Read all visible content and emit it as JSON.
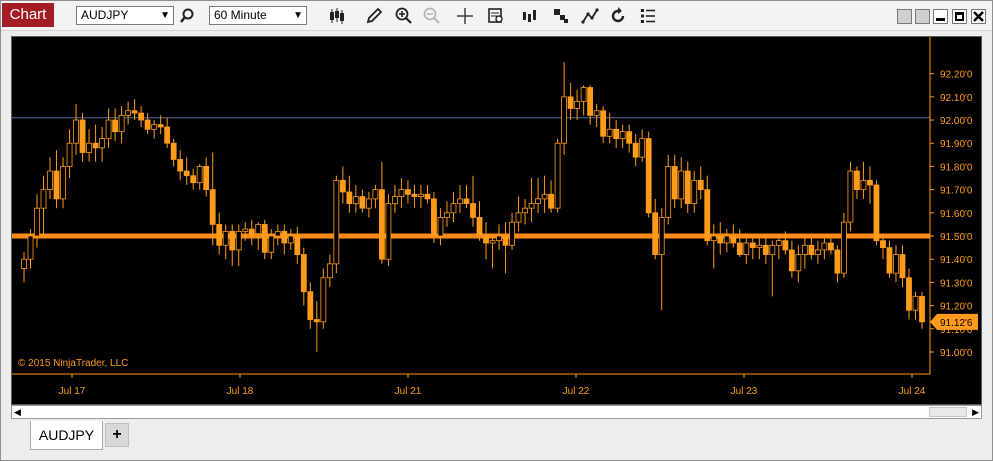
{
  "window": {
    "title": "Chart"
  },
  "toolbar": {
    "instrument": "AUDJPY",
    "interval": "60 Minute",
    "icons": [
      "search-icon",
      "bar-type-icon",
      "pencil-icon",
      "zoom-in-icon",
      "zoom-out-icon",
      "crosshair-icon",
      "data-box-icon",
      "indicators-icon",
      "strategies-icon",
      "drawing-tools-icon",
      "reload-icon",
      "properties-icon"
    ]
  },
  "tabs": [
    {
      "label": "AUDJPY"
    }
  ],
  "add_tab_label": "+",
  "chart_data": {
    "type": "candlestick",
    "instrument": "AUDJPY",
    "ylim": [
      90.95,
      92.27
    ],
    "y_ticks": [
      "92.20'0",
      "92.10'0",
      "92.00'0",
      "91.90'0",
      "91.80'0",
      "91.70'0",
      "91.60'0",
      "91.50'0",
      "91.40'0",
      "91.30'0",
      "91.20'0",
      "91.10'0",
      "91.00'0"
    ],
    "x_ticks": [
      "Jul 17",
      "Jul 18",
      "Jul 21",
      "Jul 22",
      "Jul 23",
      "Jul 24"
    ],
    "last_price_label": "91.12'6",
    "copyright": "© 2015 NinjaTrader, LLC",
    "horizontal_lines": [
      {
        "price": 92.01,
        "color": "#4f6f9f"
      },
      {
        "price": 91.5,
        "color": "#ff8c1a"
      }
    ],
    "colors": {
      "up": "#000000",
      "down": "#ff9b1a",
      "wick": "#ff9b1a",
      "axis_text": "#ff9b1a",
      "background": "#000000"
    },
    "candles": [
      [
        91.36,
        91.43,
        91.3,
        91.4
      ],
      [
        91.4,
        91.53,
        91.36,
        91.5
      ],
      [
        91.5,
        91.68,
        91.45,
        91.62
      ],
      [
        91.62,
        91.76,
        91.5,
        91.7
      ],
      [
        91.7,
        91.84,
        91.66,
        91.78
      ],
      [
        91.78,
        91.87,
        91.62,
        91.66
      ],
      [
        91.66,
        91.84,
        91.62,
        91.8
      ],
      [
        91.8,
        91.96,
        91.75,
        91.9
      ],
      [
        91.9,
        92.07,
        91.85,
        92.0
      ],
      [
        92.0,
        92.03,
        91.82,
        91.86
      ],
      [
        91.86,
        91.96,
        91.82,
        91.9
      ],
      [
        91.9,
        91.98,
        91.82,
        91.88
      ],
      [
        91.88,
        91.97,
        91.82,
        91.92
      ],
      [
        91.92,
        92.05,
        91.88,
        92.0
      ],
      [
        92.0,
        92.05,
        91.91,
        91.95
      ],
      [
        91.95,
        92.06,
        91.9,
        92.02
      ],
      [
        92.02,
        92.08,
        91.98,
        92.04
      ],
      [
        92.04,
        92.09,
        92.0,
        92.03
      ],
      [
        92.03,
        92.06,
        91.97,
        92.0
      ],
      [
        92.0,
        92.03,
        91.94,
        91.96
      ],
      [
        91.96,
        92.0,
        91.92,
        91.98
      ],
      [
        91.98,
        92.02,
        91.94,
        91.97
      ],
      [
        91.97,
        92.01,
        91.88,
        91.9
      ],
      [
        91.9,
        91.92,
        91.8,
        91.83
      ],
      [
        91.83,
        91.87,
        91.74,
        91.78
      ],
      [
        91.78,
        91.84,
        91.72,
        91.76
      ],
      [
        91.76,
        91.79,
        91.7,
        91.73
      ],
      [
        91.73,
        91.81,
        91.7,
        91.8
      ],
      [
        91.8,
        91.84,
        91.67,
        91.7
      ],
      [
        91.7,
        91.86,
        91.46,
        91.55
      ],
      [
        91.55,
        91.6,
        91.42,
        91.46
      ],
      [
        91.46,
        91.55,
        91.4,
        91.52
      ],
      [
        91.52,
        91.55,
        91.37,
        91.44
      ],
      [
        91.44,
        91.55,
        91.37,
        91.52
      ],
      [
        91.52,
        91.56,
        91.48,
        91.53
      ],
      [
        91.53,
        91.57,
        91.46,
        91.51
      ],
      [
        91.51,
        91.56,
        91.44,
        91.55
      ],
      [
        91.55,
        91.57,
        91.4,
        91.43
      ],
      [
        91.43,
        91.53,
        91.4,
        91.5
      ],
      [
        91.5,
        91.55,
        91.46,
        91.52
      ],
      [
        91.52,
        91.55,
        91.42,
        91.47
      ],
      [
        91.47,
        91.53,
        91.44,
        91.5
      ],
      [
        91.5,
        91.54,
        91.38,
        91.42
      ],
      [
        91.42,
        91.45,
        91.2,
        91.26
      ],
      [
        91.26,
        91.3,
        91.1,
        91.14
      ],
      [
        91.14,
        91.22,
        91.0,
        91.13
      ],
      [
        91.13,
        91.36,
        91.1,
        91.32
      ],
      [
        91.32,
        91.42,
        91.28,
        91.38
      ],
      [
        91.38,
        91.76,
        91.34,
        91.74
      ],
      [
        91.74,
        91.8,
        91.64,
        91.69
      ],
      [
        91.69,
        91.76,
        91.6,
        91.64
      ],
      [
        91.64,
        91.72,
        91.6,
        91.67
      ],
      [
        91.67,
        91.7,
        91.6,
        91.62
      ],
      [
        91.62,
        91.69,
        91.58,
        91.66
      ],
      [
        91.66,
        91.72,
        91.62,
        91.7
      ],
      [
        91.7,
        91.82,
        91.38,
        91.4
      ],
      [
        91.4,
        91.68,
        91.37,
        91.64
      ],
      [
        91.64,
        91.72,
        91.6,
        91.67
      ],
      [
        91.67,
        91.75,
        91.62,
        91.7
      ],
      [
        91.7,
        91.74,
        91.64,
        91.68
      ],
      [
        91.68,
        91.72,
        91.62,
        91.67
      ],
      [
        91.67,
        91.72,
        91.62,
        91.68
      ],
      [
        91.68,
        91.72,
        91.64,
        91.66
      ],
      [
        91.66,
        91.69,
        91.47,
        91.5
      ],
      [
        91.5,
        91.62,
        91.46,
        91.58
      ],
      [
        91.58,
        91.65,
        91.54,
        91.6
      ],
      [
        91.6,
        91.69,
        91.56,
        91.64
      ],
      [
        91.64,
        91.72,
        91.6,
        91.66
      ],
      [
        91.66,
        91.72,
        91.62,
        91.64
      ],
      [
        91.64,
        91.76,
        91.54,
        91.58
      ],
      [
        91.58,
        91.65,
        91.48,
        91.5
      ],
      [
        91.5,
        91.56,
        91.4,
        91.47
      ],
      [
        91.47,
        91.5,
        91.36,
        91.48
      ],
      [
        91.48,
        91.55,
        91.44,
        91.5
      ],
      [
        91.5,
        91.56,
        91.34,
        91.46
      ],
      [
        91.46,
        91.6,
        91.44,
        91.56
      ],
      [
        91.56,
        91.67,
        91.52,
        91.6
      ],
      [
        91.6,
        91.66,
        91.55,
        91.62
      ],
      [
        91.62,
        91.75,
        91.56,
        91.64
      ],
      [
        91.64,
        91.75,
        91.6,
        91.66
      ],
      [
        91.66,
        91.76,
        91.6,
        91.68
      ],
      [
        91.68,
        91.74,
        91.6,
        91.62
      ],
      [
        91.62,
        91.92,
        91.6,
        91.9
      ],
      [
        91.9,
        92.25,
        91.85,
        92.1
      ],
      [
        92.1,
        92.16,
        92.0,
        92.05
      ],
      [
        92.05,
        92.13,
        92.0,
        92.08
      ],
      [
        92.08,
        92.15,
        92.02,
        92.14
      ],
      [
        92.14,
        92.15,
        91.98,
        92.02
      ],
      [
        92.02,
        92.07,
        91.97,
        92.04
      ],
      [
        92.04,
        92.06,
        91.9,
        91.93
      ],
      [
        91.93,
        92.03,
        91.9,
        91.96
      ],
      [
        91.96,
        92.0,
        91.88,
        91.92
      ],
      [
        91.92,
        91.98,
        91.88,
        91.95
      ],
      [
        91.95,
        91.98,
        91.86,
        91.9
      ],
      [
        91.9,
        91.94,
        91.8,
        91.84
      ],
      [
        91.84,
        91.96,
        91.82,
        91.92
      ],
      [
        91.92,
        91.95,
        91.58,
        91.6
      ],
      [
        91.6,
        91.66,
        91.4,
        91.42
      ],
      [
        91.42,
        91.62,
        91.18,
        91.58
      ],
      [
        91.58,
        91.85,
        91.55,
        91.8
      ],
      [
        91.8,
        91.85,
        91.62,
        91.66
      ],
      [
        91.66,
        91.84,
        91.62,
        91.78
      ],
      [
        91.78,
        91.82,
        91.6,
        91.64
      ],
      [
        91.64,
        91.78,
        91.6,
        91.74
      ],
      [
        91.74,
        91.8,
        91.66,
        91.7
      ],
      [
        91.7,
        91.76,
        91.46,
        91.48
      ],
      [
        91.48,
        91.55,
        91.36,
        91.5
      ],
      [
        91.5,
        91.56,
        91.42,
        91.47
      ],
      [
        91.47,
        91.53,
        91.43,
        91.5
      ],
      [
        91.5,
        91.55,
        91.45,
        91.47
      ],
      [
        91.47,
        91.53,
        91.41,
        91.42
      ],
      [
        91.42,
        91.5,
        91.38,
        91.47
      ],
      [
        91.47,
        91.5,
        91.4,
        91.45
      ],
      [
        91.45,
        91.5,
        91.4,
        91.46
      ],
      [
        91.46,
        91.5,
        91.38,
        91.42
      ],
      [
        91.42,
        91.48,
        91.24,
        91.46
      ],
      [
        91.46,
        91.5,
        91.4,
        91.48
      ],
      [
        91.48,
        91.52,
        91.42,
        91.44
      ],
      [
        91.44,
        91.48,
        91.32,
        91.35
      ],
      [
        91.35,
        91.46,
        91.3,
        91.42
      ],
      [
        91.42,
        91.5,
        91.36,
        91.46
      ],
      [
        91.46,
        91.5,
        91.4,
        91.42
      ],
      [
        91.42,
        91.48,
        91.38,
        91.44
      ],
      [
        91.44,
        91.5,
        91.4,
        91.47
      ],
      [
        91.47,
        91.5,
        91.42,
        91.44
      ],
      [
        91.44,
        91.46,
        91.3,
        91.34
      ],
      [
        91.34,
        91.6,
        91.32,
        91.56
      ],
      [
        91.56,
        91.82,
        91.52,
        91.78
      ],
      [
        91.78,
        91.8,
        91.66,
        91.7
      ],
      [
        91.7,
        91.82,
        91.66,
        91.74
      ],
      [
        91.74,
        91.8,
        91.64,
        91.72
      ],
      [
        91.72,
        91.74,
        91.46,
        91.48
      ],
      [
        91.48,
        91.5,
        91.4,
        91.45
      ],
      [
        91.45,
        91.48,
        91.32,
        91.34
      ],
      [
        91.34,
        91.46,
        91.3,
        91.42
      ],
      [
        91.42,
        91.46,
        91.28,
        91.32
      ],
      [
        91.32,
        91.36,
        91.14,
        91.18
      ],
      [
        91.18,
        91.26,
        91.14,
        91.24
      ],
      [
        91.24,
        91.26,
        91.1,
        91.13
      ]
    ]
  }
}
